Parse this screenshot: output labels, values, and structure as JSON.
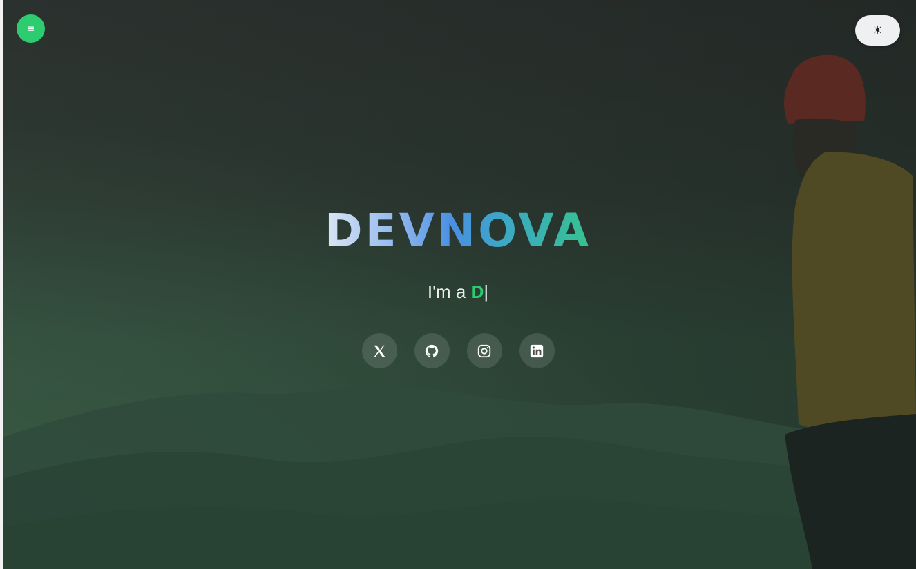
{
  "header": {
    "menu_icon": "≡",
    "theme_icon": "☀"
  },
  "hero": {
    "brand": "DEVNOVA",
    "tagline_prefix": "I'm a ",
    "tagline_typed": "D",
    "tagline_cursor": "|"
  },
  "socials": [
    {
      "name": "x-twitter",
      "icon": "x-icon"
    },
    {
      "name": "github",
      "icon": "github-icon"
    },
    {
      "name": "instagram",
      "icon": "instagram-icon"
    },
    {
      "name": "linkedin",
      "icon": "linkedin-icon"
    }
  ],
  "colors": {
    "accent": "#2ecc71",
    "background": "#2d3a33",
    "brand_gradient": [
      "#dbe6f4",
      "#4a8fe2",
      "#36c290"
    ]
  }
}
